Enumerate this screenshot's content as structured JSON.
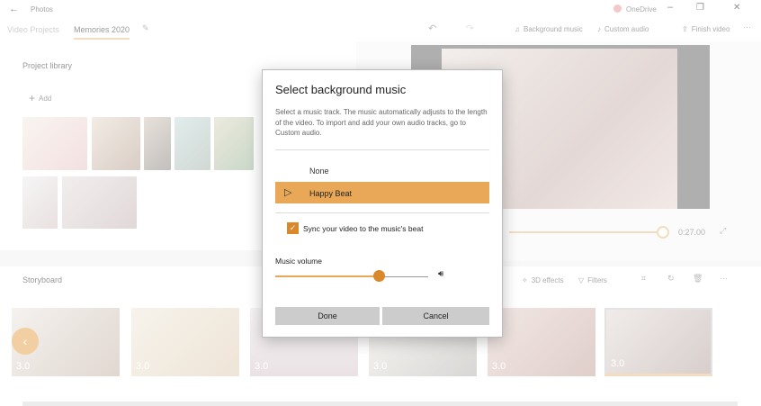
{
  "app": {
    "title": "Photos",
    "onedrive": "OneDrive"
  },
  "tabs": {
    "video_projects": "Video Projects",
    "current": "Memories 2020"
  },
  "toolbar": {
    "background_music": "Background music",
    "custom_audio": "Custom audio",
    "finish_video": "Finish video"
  },
  "library": {
    "title": "Project library",
    "add": "Add"
  },
  "preview": {
    "time": "0:27.00",
    "progress": 0.87
  },
  "storyboard": {
    "title": "Storyboard",
    "effects_3d": "3D effects",
    "filters": "Filters",
    "durations": [
      "3.0",
      "3.0",
      "3.0",
      "3.0",
      "3.0",
      "3.0"
    ]
  },
  "dialog": {
    "title": "Select background music",
    "description": "Select a music track. The music automatically adjusts to the length of the video. To import and add your own audio tracks, go to Custom audio.",
    "tracks": [
      "None",
      "Happy Beat"
    ],
    "selected_track": "Happy Beat",
    "sync_label": "Sync your video to the music's beat",
    "sync_checked": true,
    "volume_label": "Music volume",
    "volume": 0.7,
    "done": "Done",
    "cancel": "Cancel"
  },
  "colors": {
    "accent": "#e8a857",
    "check": "#d9892a"
  }
}
